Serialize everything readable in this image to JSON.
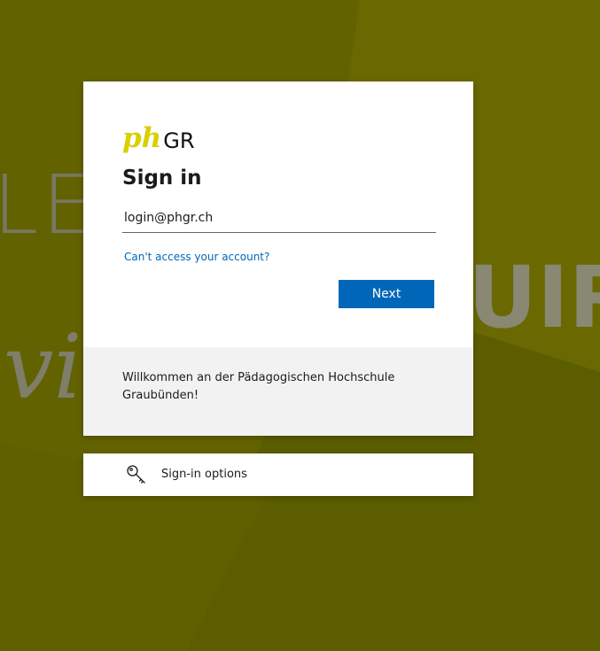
{
  "background": {
    "text_le": "LE",
    "text_uir": "UIR",
    "text_vi": "vi"
  },
  "logo": {
    "ph": "ph",
    "gr": "GR"
  },
  "signin": {
    "title": "Sign in",
    "email_value": "login@phgr.ch",
    "cant_access_label": "Can't access your account?",
    "next_label": "Next"
  },
  "welcome": {
    "text": "Willkommen an der Pädagogischen Hochschule Graubünden!"
  },
  "options": {
    "icon": "key-icon",
    "label": "Sign-in options"
  },
  "colors": {
    "accent": "#0067b8",
    "logo_yellow": "#d8d000",
    "background": "#6b6a00"
  }
}
